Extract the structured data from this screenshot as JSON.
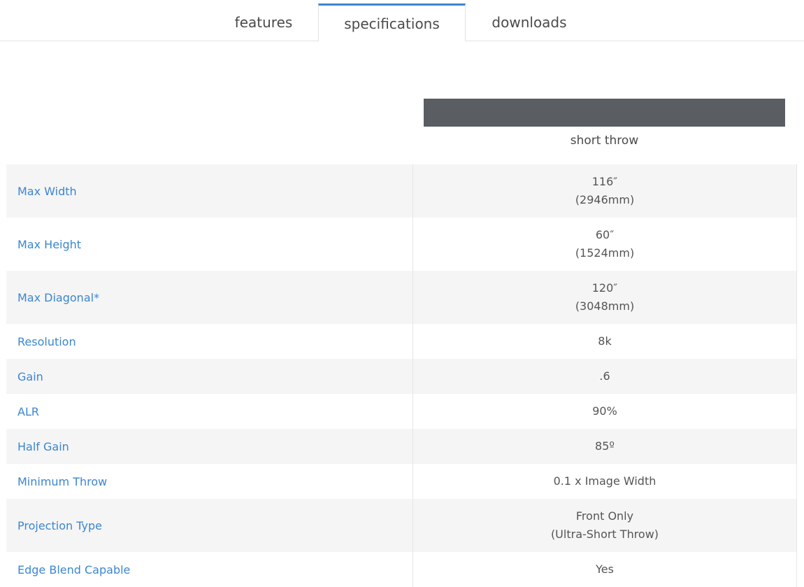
{
  "tabs": [
    {
      "label": "features"
    },
    {
      "label": "specifications"
    },
    {
      "label": "downloads"
    }
  ],
  "column": {
    "label": "short throw"
  },
  "specs": [
    {
      "label": "Max Width",
      "value": "116″",
      "sub": "(2946mm)"
    },
    {
      "label": "Max Height",
      "value": "60″",
      "sub": "(1524mm)"
    },
    {
      "label": "Max Diagonal*",
      "value": "120″",
      "sub": "(3048mm)"
    },
    {
      "label": "Resolution",
      "value": "8k"
    },
    {
      "label": "Gain",
      "value": ".6"
    },
    {
      "label": "ALR",
      "value": "90%"
    },
    {
      "label": "Half Gain",
      "value": "85º"
    },
    {
      "label": "Minimum Throw",
      "value": "0.1 x Image Width"
    },
    {
      "label": "Projection Type",
      "value": "Front Only",
      "sub": "(Ultra-Short Throw)"
    },
    {
      "label": "Edge Blend Capable",
      "value": "Yes"
    }
  ],
  "colors": {
    "accent": "#3b86d1",
    "header_bar": "#5a5e62",
    "row_shade": "#f5f5f5"
  }
}
